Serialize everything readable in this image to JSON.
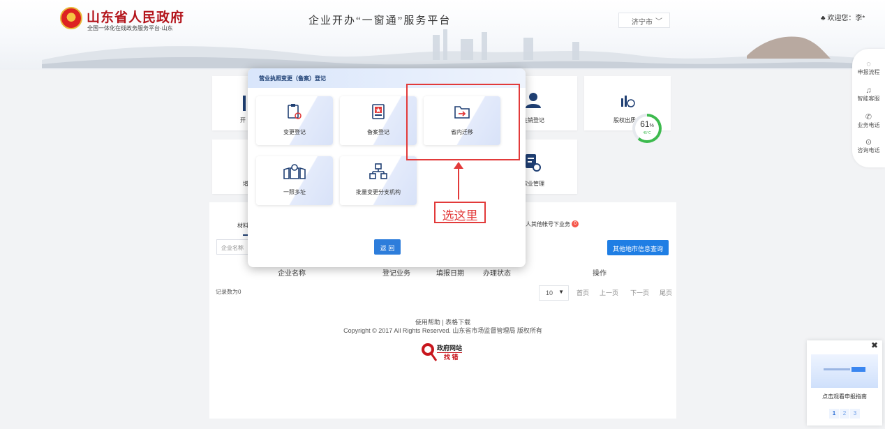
{
  "header": {
    "gov_title": "山东省人民政府",
    "gov_subtitle": "全国一体化在线政务服务平台·山东",
    "platform_title": "企业开办“一窗通”服务平台",
    "city": "济宁市",
    "welcome": "♣ 欢迎您：李*"
  },
  "side_dock": [
    {
      "icon": "flow-icon",
      "glyph": "◌",
      "label": "申报流程"
    },
    {
      "icon": "headset-icon",
      "glyph": "♫",
      "label": "智能客服"
    },
    {
      "icon": "phone-icon",
      "glyph": "✆",
      "label": "业务电话"
    },
    {
      "icon": "chat-icon",
      "glyph": "⊙",
      "label": "咨询电话"
    }
  ],
  "grid": {
    "card1_frag": "开",
    "card4_label": "注销登记",
    "card5_label": "股权出质",
    "card6_frag": "增",
    "card8_label": "歇业管理"
  },
  "main": {
    "tab_frag": "材料",
    "other_tab_frag": "人其他帐号下业务",
    "other_tab_badge": "0",
    "search_placeholder": "企业名称",
    "other_city_button": "其他地市信息查询",
    "table_headers": [
      "企业名称",
      "登记业务",
      "填报日期",
      "办理状态",
      "操作"
    ],
    "records": "记录数为0",
    "page_size": "10",
    "pager": [
      "首页",
      "上一页",
      "下一页",
      "尾页"
    ],
    "footer_links": "使用帮助 | 表格下载",
    "copyright": "Copyright © 2017 All Rights Reserved. 山东省市场监督管理局 版权所有",
    "find_error_line1": "政府网站",
    "find_error_line2": "找 错"
  },
  "modal": {
    "title": "营业执照变更（备案）登记",
    "options": [
      {
        "label": "变更登记",
        "icon": "clipboard-refresh-icon"
      },
      {
        "label": "备案登记",
        "icon": "star-document-icon"
      },
      {
        "label": "省内迁移",
        "icon": "folder-transfer-icon"
      },
      {
        "label": "一照多址",
        "icon": "map-location-icon"
      },
      {
        "label": "批量变更分支机构",
        "icon": "org-chart-icon"
      }
    ],
    "return_button": "返 回"
  },
  "annotation": {
    "text": "选这里",
    "color": "#e23a3a"
  },
  "gauge": {
    "percent": 61,
    "value_text": "61",
    "unit": "%",
    "temp": "45℃"
  },
  "guide": {
    "text": "点击观看申报指南",
    "pages": [
      "1",
      "2",
      "3"
    ]
  },
  "colors": {
    "primary": "#1f7ee4",
    "brand_red": "#b3131a"
  }
}
